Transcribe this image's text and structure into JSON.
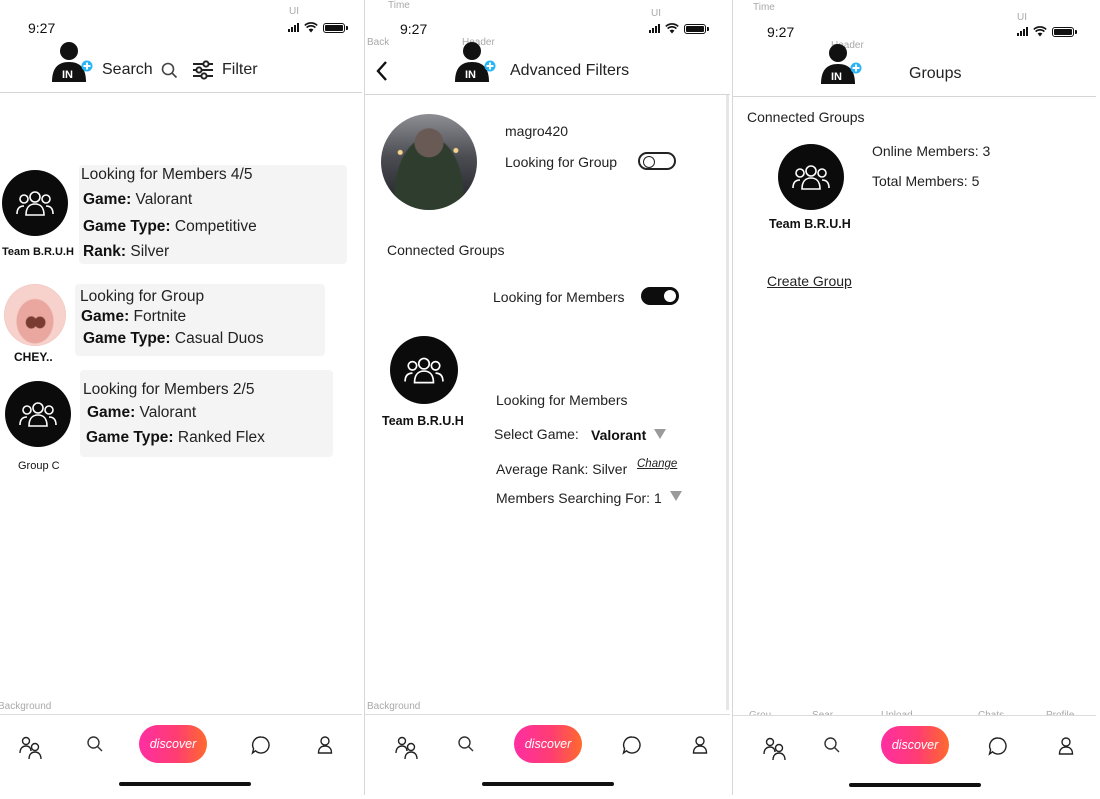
{
  "status": {
    "time": "9:27"
  },
  "ghost_labels": {
    "time": "Time",
    "ui": "UI",
    "back": "Back",
    "header": "Header",
    "background": "Background"
  },
  "screen1": {
    "search_label": "Search",
    "filter_label": "Filter",
    "cards": [
      {
        "avatar_label": "Team B.R.U.H",
        "title": "Looking for Members 4/5",
        "game_key": "Game:",
        "game": " Valorant",
        "type_key": "Game Type:",
        "type": " Competitive",
        "rank_key": "Rank:",
        "rank": " Silver"
      },
      {
        "avatar_label": "CHEY..",
        "title": "Looking for Group",
        "game_key": "Game:",
        "game": " Fortnite",
        "type_key": "Game Type:",
        "type": " Casual Duos"
      },
      {
        "avatar_label": "Group C",
        "title": "Looking for Members 2/5",
        "game_key": "Game:",
        "game": " Valorant",
        "type_key": "Game Type:",
        "type": " Ranked Flex"
      }
    ]
  },
  "screen2": {
    "title": "Advanced Filters",
    "username": "magro420",
    "looking_for_group": "Looking for Group",
    "looking_for_group_on": false,
    "connected_groups": "Connected Groups",
    "looking_for_members": "Looking for Members",
    "looking_for_members_on": true,
    "group_name": "Team B.R.U.H",
    "lfm_heading": "Looking for Members",
    "select_game_label": "Select Game:",
    "select_game_value": "Valorant",
    "average_rank": "Average Rank: Silver",
    "change_link": "Change",
    "members_searching": "Members Searching For: 1"
  },
  "screen3": {
    "title": "Groups",
    "connected_groups": "Connected Groups",
    "group_name": "Team B.R.U.H",
    "online_members": "Online Members: 3",
    "total_members": "Total Members: 5",
    "create_group": "Create Group"
  },
  "tabbar": {
    "discover": "discover",
    "labels": [
      "Grou...",
      "Sear...",
      "Upload",
      "Chats",
      "Profile"
    ],
    "icons": [
      "groups-icon",
      "search-icon",
      "discover-button",
      "chat-icon",
      "profile-icon"
    ]
  },
  "colors": {
    "discover_gradient": [
      "#ff2ea2",
      "#ff6a2d"
    ],
    "logo_plus": "#29b6f6"
  }
}
